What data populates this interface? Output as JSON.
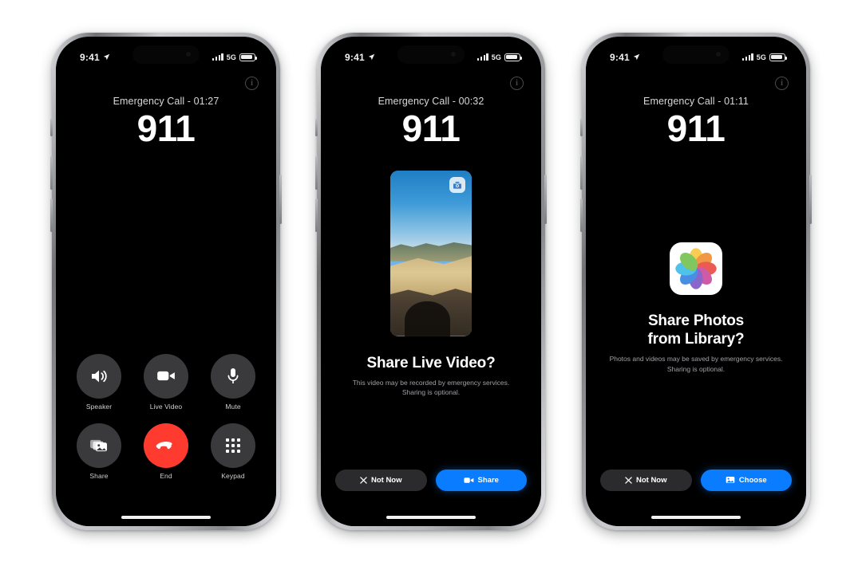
{
  "scene": {
    "background_color": "#ffffff",
    "accent_blue": "#0a7cff",
    "end_call_red": "#ff3b30",
    "control_gray": "#3a3a3c"
  },
  "status_bar": {
    "time": "9:41",
    "network": "5G",
    "location_icon": "location-arrow-icon",
    "signal_icon": "cellular-bars-icon",
    "battery_icon": "battery-icon"
  },
  "phones": [
    {
      "id": "phone-call-controls",
      "call_status": "Emergency Call - 01:27",
      "call_number": "911",
      "info_glyph": "i",
      "controls": [
        {
          "label": "Speaker",
          "icon": "speaker-icon"
        },
        {
          "label": "Live Video",
          "icon": "video-camera-icon"
        },
        {
          "label": "Mute",
          "icon": "microphone-icon"
        },
        {
          "label": "Share",
          "icon": "photo-stack-icon"
        },
        {
          "label": "End",
          "icon": "end-call-icon"
        },
        {
          "label": "Keypad",
          "icon": "keypad-icon"
        }
      ]
    },
    {
      "id": "phone-share-live-video",
      "call_status": "Emergency Call - 00:32",
      "call_number": "911",
      "info_glyph": "i",
      "flip_camera_icon": "camera-flip-icon",
      "prompt_title": "Share Live Video?",
      "prompt_subtitle": "This video may be recorded by emergency services. Sharing is optional.",
      "secondary_button": {
        "label": "Not Now",
        "icon": "close-icon"
      },
      "primary_button": {
        "label": "Share",
        "icon": "video-camera-icon"
      }
    },
    {
      "id": "phone-share-photos",
      "call_status": "Emergency Call - 01:11",
      "call_number": "911",
      "info_glyph": "i",
      "app_icon": "photos-app-icon",
      "prompt_title_line1": "Share Photos",
      "prompt_title_line2": "from Library?",
      "prompt_subtitle": "Photos and videos may be saved by emergency services. Sharing is optional.",
      "secondary_button": {
        "label": "Not Now",
        "icon": "close-icon"
      },
      "primary_button": {
        "label": "Choose",
        "icon": "photo-icon"
      }
    }
  ]
}
